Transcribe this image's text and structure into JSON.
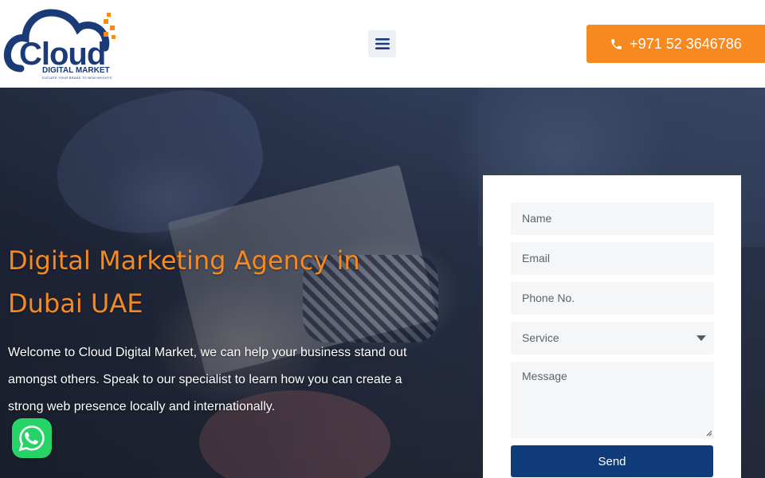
{
  "header": {
    "logo": {
      "word": "Cloud",
      "subtitle": "DIGITAL MARKET",
      "tagline": "ELEVATE YOUR BRAND TO NEW HEIGHTS"
    },
    "menu_icon": "hamburger-menu-icon",
    "phone": {
      "icon": "phone-icon",
      "label": "+971 52 3646786"
    }
  },
  "hero": {
    "title": "Digital Marketing Agency in Dubai UAE",
    "text": "Welcome to Cloud Digital Market, we can help your business stand out amongst others. Speak to our specialist to learn how you can create a strong web presence locally and internationally."
  },
  "form": {
    "name_placeholder": "Name",
    "email_placeholder": "Email",
    "phone_placeholder": "Phone No.",
    "service_selected": "Service",
    "message_placeholder": "Message",
    "send_label": "Send"
  },
  "whatsapp": {
    "icon": "whatsapp-icon"
  },
  "colors": {
    "accent_orange": "#f6891f",
    "brand_navy": "#0f3b7a",
    "logo_navy": "#1b3a78",
    "whatsapp_green": "#25d366"
  }
}
